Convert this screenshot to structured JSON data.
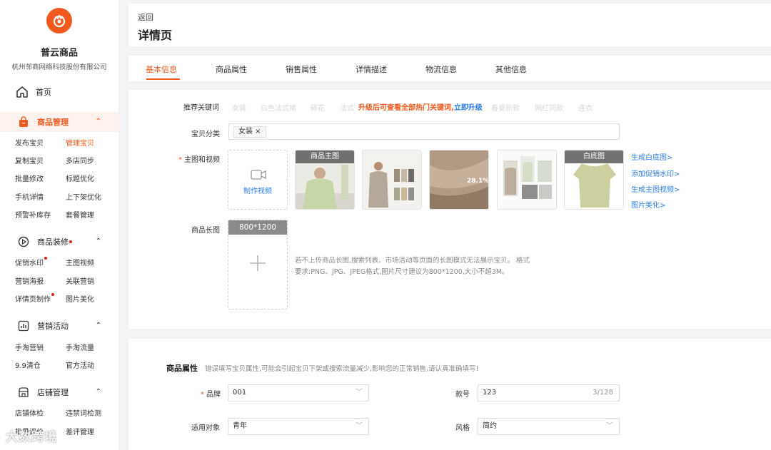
{
  "brand": {
    "name": "普云商品",
    "company": "杭州邻商网络科技股份有限公司",
    "accent": "#f2591c"
  },
  "nav": {
    "home": "首页",
    "groups": [
      {
        "title": "商品管理",
        "icon": "shopping-bag-icon",
        "items": [
          "发布宝贝",
          "管理宝贝",
          "复制宝贝",
          "多店同步",
          "批量修改",
          "标题优化",
          "手机详情",
          "上下架优化",
          "预警补库存",
          "套餐管理"
        ],
        "active_item": "管理宝贝"
      },
      {
        "title": "商品装修",
        "icon": "play-circle-icon",
        "items": [
          "促销水印",
          "主图视频",
          "营销海报",
          "关联营销",
          "详情页制作",
          "图片美化"
        ]
      },
      {
        "title": "营销活动",
        "icon": "bar-chart-icon",
        "items": [
          "手淘营销",
          "手淘流量",
          "9.9清仓",
          "官方活动"
        ]
      },
      {
        "title": "店铺管理",
        "icon": "store-icon",
        "items": [
          "店铺体检",
          "违禁词检测",
          "批量评价",
          "差评管理"
        ]
      }
    ]
  },
  "header": {
    "back": "返回",
    "title": "详情页"
  },
  "tabs": [
    "基本信息",
    "商品属性",
    "销售属性",
    "详情描述",
    "物流信息",
    "其他信息"
  ],
  "form": {
    "keywords_label": "推荐关键词",
    "keywords": [
      "女装",
      "白色法式裙",
      "碎花",
      "法式"
    ],
    "keywords_after": [
      "春夏新款",
      "网红同款",
      "连衣"
    ],
    "upsell_text": "升级后可查看全部热门关键词,",
    "upsell_link": "立即升级",
    "category_label": "宝贝分类",
    "category_chip": "女装 ×",
    "main_media_label": "主图和视频",
    "make_video": "制作视频",
    "thumb_tag_main": "商品主图",
    "thumb_tag_white": "白底图",
    "actions": [
      "生成白底图>",
      "添加促销水印>",
      "生成主图视频>",
      "图片美化>"
    ],
    "long_image_label": "商品长图",
    "long_image_size": "800*1200",
    "hint1": "若不上传商品长图,搜索列表、市场活动等页面的长图模式无法展示宝贝。 格式",
    "hint2": "要求:PNG、JPG、JPEG格式,图片尺寸建议为800*1200,大小不超3M。",
    "thumb3_text1": "28.1%"
  },
  "attributes": {
    "title": "商品属性",
    "note": "错误填写宝贝属性,可能会引起宝贝下架或搜索流量减少,影响您的正常销售,请认真准确填写!",
    "brand_label": "品牌",
    "brand_value": "001",
    "style_no_label": "款号",
    "style_no_value": "123",
    "style_no_count": "3/128",
    "target_label": "适用对象",
    "target_value": "青年",
    "style_label": "风格",
    "style_value": "简约"
  },
  "watermark": "大数跨境"
}
